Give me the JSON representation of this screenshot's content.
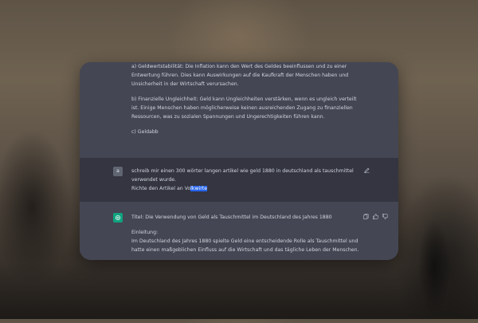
{
  "previous_response": {
    "paragraphs": [
      "a) Geldwertstabilität: Die Inflation kann den Wert des Geldes beeinflussen und zu einer Entwertung führen. Dies kann Auswirkungen auf die Kaufkraft der Menschen haben und Unsicherheit in der Wirtschaft verursachen.",
      "b) Finanzielle Ungleichheit: Geld kann Ungleichheiten verstärken, wenn es ungleich verteilt ist. Einige Menschen haben möglicherweise keinen ausreichenden Zugang zu finanziellen Ressourcen, was zu sozialen Spannungen und Ungerechtigkeiten führen kann.",
      "c) Geldabb"
    ]
  },
  "user_message": {
    "avatar_letter": "a",
    "line1": "schreib mir einen 300 wörter langen artikel wie geld 1880 in deutschland als tauschmittel verwendet wurde.",
    "line2_prefix": "Richte den Artikel an Vo",
    "line2_selected": "lkwirte",
    "edit_icon": "pencil-edit-icon"
  },
  "assistant_message": {
    "title": "Titel: Die Verwendung von Geld als Tauschmittel im Deutschland des Jahres 1880",
    "intro_heading": "Einleitung:",
    "intro_text": "Im Deutschland des Jahres 1880 spielte Geld eine entscheidende Rolle als Tauschmittel und hatte einen maßgeblichen Einfluss auf die Wirtschaft und das tägliche Leben der Menschen.",
    "actions": [
      "copy-icon",
      "thumbs-up-icon",
      "thumbs-down-icon"
    ]
  },
  "colors": {
    "assistant_bg": "#444654",
    "user_bg": "#343541",
    "selection": "#2563eb",
    "gpt_avatar": "#10a37f"
  }
}
